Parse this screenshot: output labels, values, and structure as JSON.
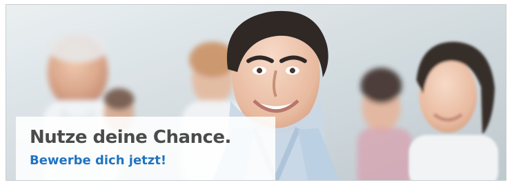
{
  "banner": {
    "headline": "Nutze deine Chance.",
    "cta_label": "Bewerbe dich jetzt!",
    "image_subject": "smiling-group-photo",
    "colors": {
      "headline": "#4b4b4b",
      "cta": "#1f74c1",
      "card_background": "#ffffff"
    }
  }
}
